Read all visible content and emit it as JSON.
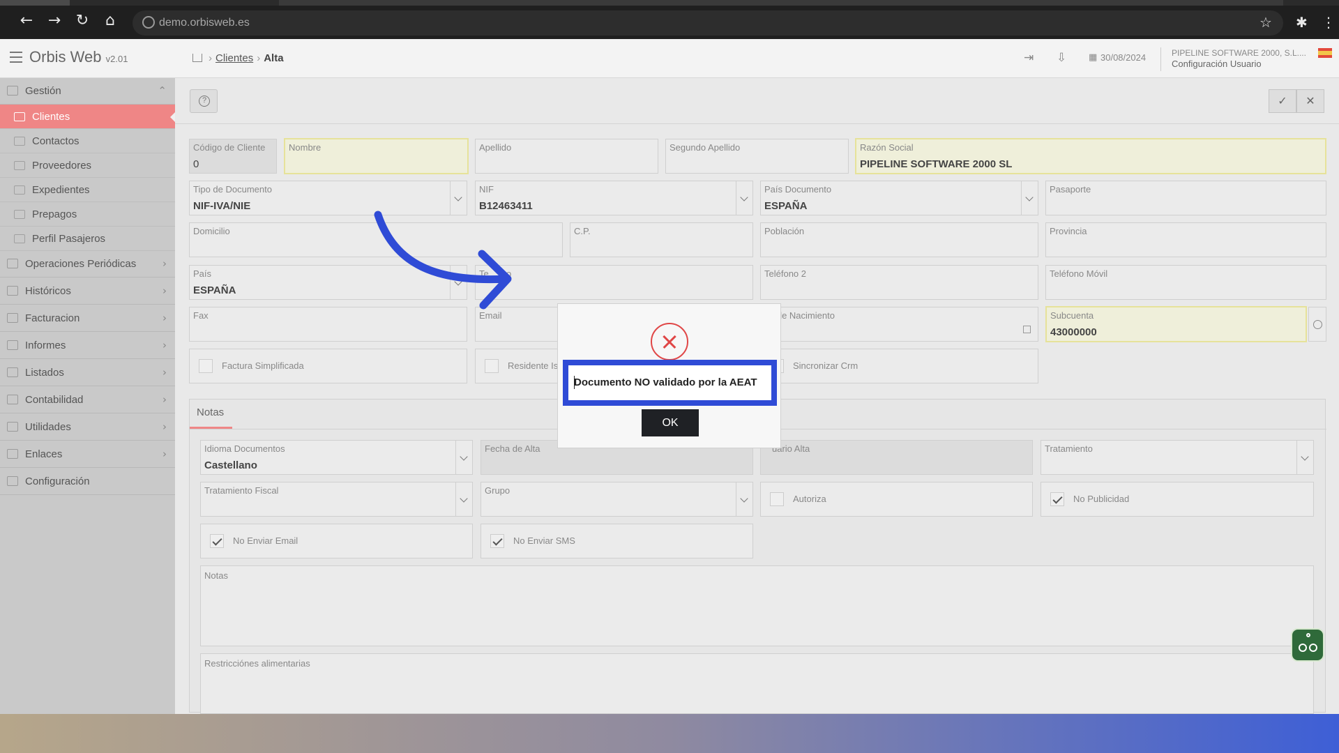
{
  "browser": {
    "url": "demo.orbisweb.es"
  },
  "header": {
    "app_title": "Orbis Web",
    "version": "v2.01",
    "breadcrumb": {
      "link": "Clientes",
      "current": "Alta"
    },
    "date": "30/08/2024",
    "company": "PIPELINE SOFTWARE 2000, S.L....",
    "config": "Configuración Usuario"
  },
  "sidebar": {
    "groups": [
      {
        "label": "Gestión"
      },
      {
        "label": "Operaciones Periódicas"
      },
      {
        "label": "Históricos"
      },
      {
        "label": "Facturacion"
      },
      {
        "label": "Informes"
      },
      {
        "label": "Listados"
      },
      {
        "label": "Contabilidad"
      },
      {
        "label": "Utilidades"
      },
      {
        "label": "Enlaces"
      },
      {
        "label": "Configuración"
      }
    ],
    "items": [
      {
        "label": "Clientes"
      },
      {
        "label": "Contactos"
      },
      {
        "label": "Proveedores"
      },
      {
        "label": "Expedientes"
      },
      {
        "label": "Prepagos"
      },
      {
        "label": "Perfil Pasajeros"
      }
    ]
  },
  "form": {
    "codigo_cliente": {
      "label": "Código de Cliente",
      "value": "0"
    },
    "nombre": {
      "label": "Nombre",
      "value": ""
    },
    "apellido": {
      "label": "Apellido",
      "value": ""
    },
    "segundo_apellido": {
      "label": "Segundo Apellido",
      "value": ""
    },
    "razon_social": {
      "label": "Razón Social",
      "value": "PIPELINE SOFTWARE 2000 SL"
    },
    "tipo_documento": {
      "label": "Tipo de Documento",
      "value": "NIF-IVA/NIE"
    },
    "nif": {
      "label": "NIF",
      "value": "B12463411"
    },
    "pais_documento": {
      "label": "País Documento",
      "value": "ESPAÑA"
    },
    "pasaporte": {
      "label": "Pasaporte",
      "value": ""
    },
    "domicilio": {
      "label": "Domicilio",
      "value": ""
    },
    "cp": {
      "label": "C.P.",
      "value": ""
    },
    "poblacion": {
      "label": "Población",
      "value": ""
    },
    "provincia": {
      "label": "Provincia",
      "value": ""
    },
    "pais": {
      "label": "País",
      "value": "ESPAÑA"
    },
    "telefono": {
      "label": "Te",
      "label_end": "no",
      "value": ""
    },
    "telefono2": {
      "label": "Teléfono 2",
      "value": ""
    },
    "telefono_movil": {
      "label": "Teléfono Móvil",
      "value": ""
    },
    "fax": {
      "label": "Fax",
      "value": ""
    },
    "email": {
      "label": "Email",
      "value": ""
    },
    "fecha_nacimiento": {
      "label": "a de Nacimiento",
      "value": ""
    },
    "subcuenta": {
      "label": "Subcuenta",
      "value": "43000000"
    },
    "factura_simplificada": {
      "label": "Factura Simplificada",
      "checked": false
    },
    "residente": {
      "label": "Residente Is",
      "checked": false
    },
    "sincronizar_crm": {
      "label": "Sincronizar Crm",
      "checked": false
    }
  },
  "notes_section": {
    "tab_label": "Notas",
    "idioma": {
      "label": "Idioma Documentos",
      "value": "Castellano"
    },
    "fecha_alta": {
      "label": "Fecha de Alta",
      "value": ""
    },
    "usuario_alta": {
      "label": "uario Alta",
      "value": ""
    },
    "tratamiento": {
      "label": "Tratamiento",
      "value": ""
    },
    "tratamiento_fiscal": {
      "label": "Tratamiento Fiscal",
      "value": ""
    },
    "grupo": {
      "label": "Grupo",
      "value": ""
    },
    "autoriza": {
      "label": "Autoriza",
      "checked": false
    },
    "no_publicidad": {
      "label": "No Publicidad",
      "checked": true
    },
    "no_enviar_email": {
      "label": "No Enviar Email",
      "checked": true
    },
    "no_enviar_sms": {
      "label": "No Enviar SMS",
      "checked": true
    },
    "notas": {
      "label": "Notas"
    },
    "restricciones": {
      "label": "Restricciónes alimentarias"
    }
  },
  "dialog": {
    "message": "Documento NO validado por la AEAT",
    "ok_label": "OK"
  },
  "colors": {
    "sidebar_active": "#ef8686",
    "highlight_border": "#2f4bd6",
    "error_red": "#e04646",
    "arrow_blue": "#2f4bd6"
  }
}
